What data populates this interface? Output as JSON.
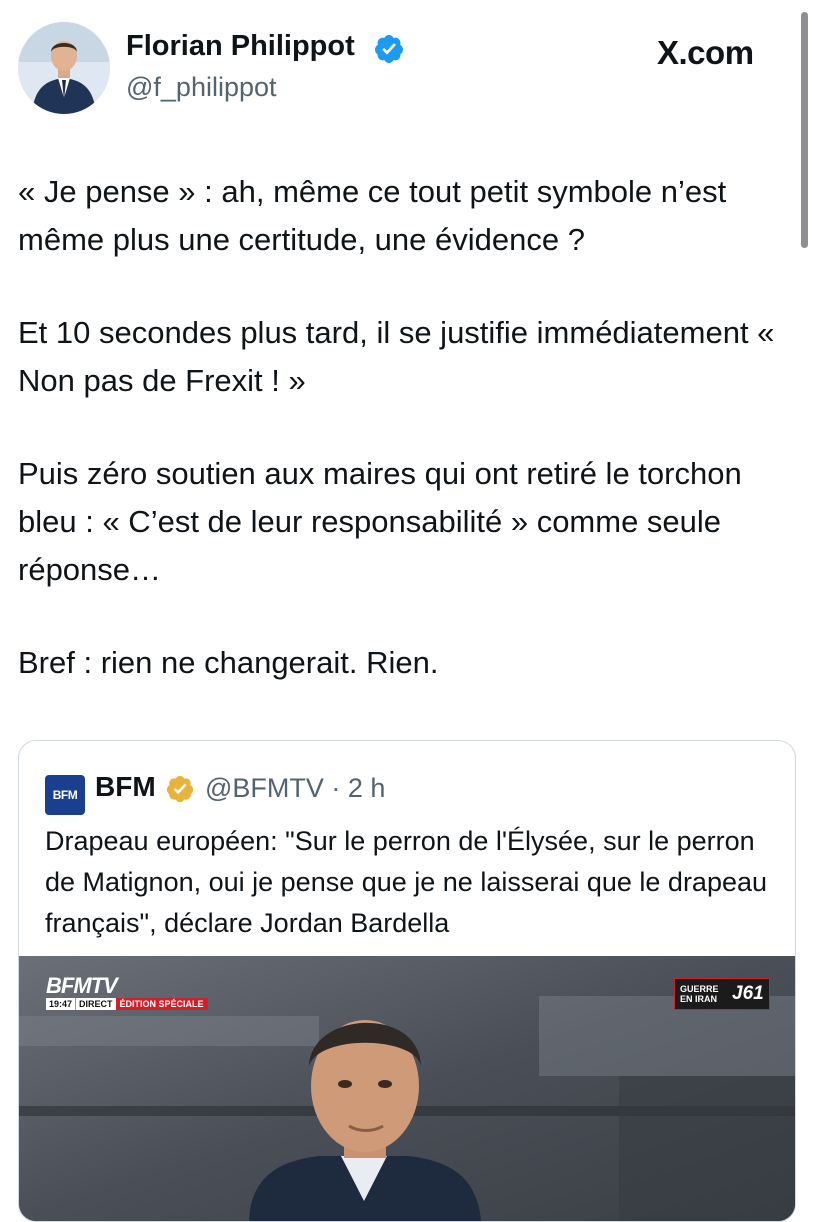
{
  "author": {
    "name": "Florian Philippot",
    "handle": "@f_philippot"
  },
  "brand": {
    "xcom": "X.com"
  },
  "tweet": {
    "paragraphs": [
      "« Je pense » : ah, même ce tout petit symbole n’est même plus une certitude, une évidence ?",
      "Et 10 secondes plus tard, il se justifie immédiatement « Non pas de Frexit ! »",
      "Puis zéro soutien aux maires qui ont retiré le torchon bleu : « C’est de leur responsabilité » comme seule réponse…",
      "Bref : rien ne changerait. Rien."
    ]
  },
  "quote": {
    "logo_text": "BFM",
    "name": "BFM",
    "handle_time": "@BFMTV · 2 h",
    "text": "Drapeau européen: \"Sur le perron de l'Élysée, sur le perron de Matignon, oui je pense que je ne laisserai que le drapeau français\", déclare Jordan Bardella",
    "media": {
      "channel": "BFMTV",
      "time": "19:47",
      "direct": "DIRECT",
      "edition": "ÉDITION SPÉCIALE",
      "guerre_line1": "GUERRE",
      "guerre_line2": "EN IRAN",
      "day": "J61"
    }
  },
  "colors": {
    "verified_blue": "#1d9bf0",
    "gold_badge": "#e8b339",
    "secondary_text": "#536471",
    "border": "#cfd9de"
  }
}
